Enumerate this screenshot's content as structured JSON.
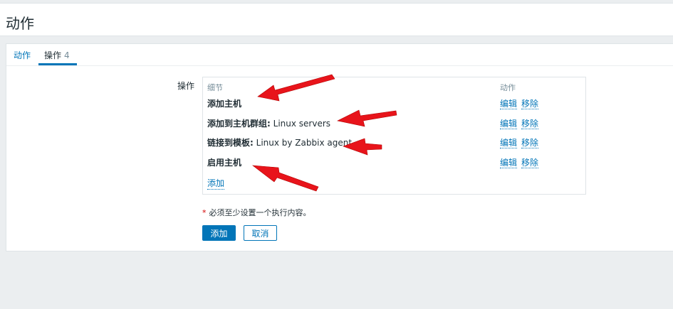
{
  "page": {
    "title": "动作"
  },
  "tabs": [
    {
      "label": "动作"
    },
    {
      "label": "操作",
      "count": "4"
    }
  ],
  "operations": {
    "label": "操作",
    "columns": {
      "details": "细节",
      "action": "动作"
    },
    "rows": [
      {
        "prefix": "添加主机",
        "value": ""
      },
      {
        "prefix": "添加到主机群组:",
        "value": " Linux servers"
      },
      {
        "prefix": "链接到模板:",
        "value": " Linux by Zabbix agent"
      },
      {
        "prefix": "启用主机",
        "value": ""
      }
    ],
    "edit_label": "编辑",
    "remove_label": "移除",
    "add_label": "添加"
  },
  "note": {
    "star": "*",
    "text": "必须至少设置一个执行内容。"
  },
  "buttons": {
    "add": "添加",
    "cancel": "取消"
  },
  "colors": {
    "accent": "#0275b8",
    "annotation_arrow": "#e8141b"
  }
}
